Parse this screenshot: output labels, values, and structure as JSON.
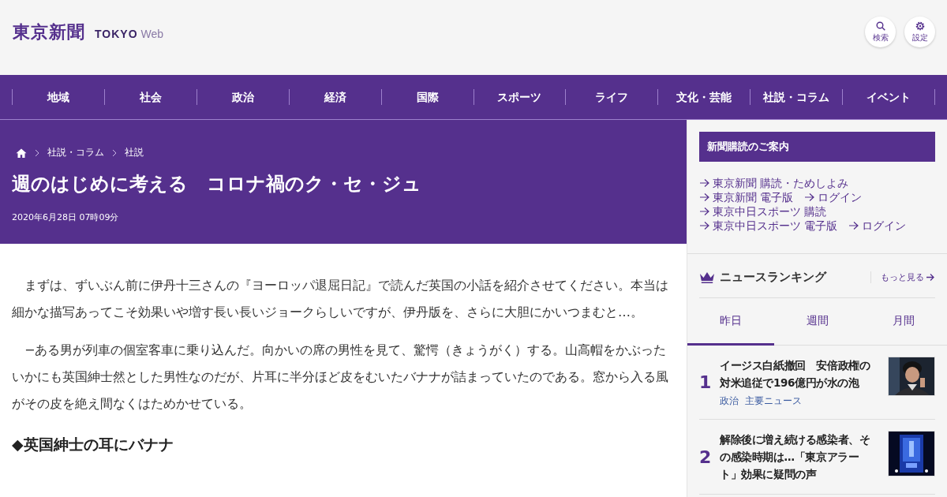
{
  "header": {
    "logo": "東京新聞",
    "logo_latin_bold": "TOKYO",
    "logo_latin_light": "Web",
    "buttons": [
      {
        "kind": "search",
        "label": "検索"
      },
      {
        "kind": "settings",
        "label": "設定"
      }
    ]
  },
  "nav": [
    "地域",
    "社会",
    "政治",
    "経済",
    "国際",
    "スポーツ",
    "ライフ",
    "文化・芸能",
    "社説・コラム",
    "イベント"
  ],
  "article": {
    "breadcrumb": [
      "社説・コラム",
      "社説"
    ],
    "title": "週のはじめに考える　コロナ禍のク・セ・ジュ",
    "date": "2020年6月28日 07時09分",
    "blocks": [
      {
        "kind": "paragraph",
        "text": "　まずは、ずいぶん前に伊丹十三さんの『ヨーロッパ退屈日記』で読んだ英国の小話を紹介させてください。本当は細かな描写あってこそ効果いや増す長い長いジョークらしいですが、伊丹版を、さらに大胆にかいつまむと…。"
      },
      {
        "kind": "paragraph",
        "text": "　−ある男が列車の個室客車に乗り込んだ。向かいの席の男性を見て、驚愕（きょうがく）する。山高帽をかぶったいかにも英国紳士然とした男性なのだが、片耳に半分ほど皮をむいたバナナが詰まっていたのである。窓から入る風がその皮を絶え間なくはためかせている。"
      },
      {
        "kind": "heading",
        "text": "◆英国紳士の耳にバナナ"
      }
    ]
  },
  "sidebar": {
    "subscribe": {
      "title": "新聞購読のご案内",
      "lines": [
        [
          "東京新聞 購読・ためしよみ"
        ],
        [
          "東京新聞 電子版",
          "ログイン"
        ],
        [
          "東京中日スポーツ 購読"
        ],
        [
          "東京中日スポーツ 電子版",
          "ログイン"
        ]
      ]
    },
    "ranking": {
      "title": "ニュースランキング",
      "more": "もっと見る",
      "tabs": [
        {
          "label": "昨日",
          "selected": true
        },
        {
          "label": "週間",
          "selected": false
        },
        {
          "label": "月間",
          "selected": false
        }
      ],
      "items": [
        {
          "rank": "1",
          "title": "イージス白紙撤回　安倍政権の対米追従で196億円が水の泡",
          "tags": [
            "政治",
            "主要ニュース"
          ],
          "kind": "picture"
        },
        {
          "rank": "2",
          "title": "解除後に増え続ける感染者、その感染時期は…「東京アラート」効果に疑問の声",
          "kind": "picture"
        }
      ]
    }
  }
}
